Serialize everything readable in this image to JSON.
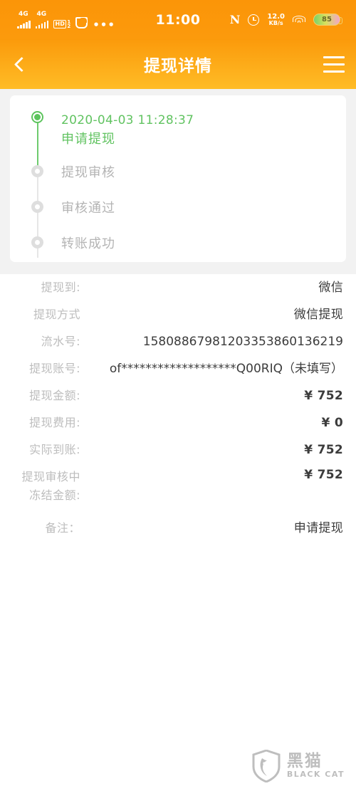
{
  "statusbar": {
    "carrier1": "4G",
    "carrier2": "4G",
    "hd_label": "HD",
    "hd_sim_top": "1",
    "hd_sim_bottom": "2",
    "more_dots": "•••",
    "clock": "11:00",
    "nfc_label": "N",
    "netspeed_value": "12.0",
    "netspeed_unit": "KB/s",
    "battery_percent": "85",
    "icons": {
      "signal": "signal-bars-icon",
      "hd": "hd-volte-icon",
      "bag": "shopping-bag-icon",
      "more": "more-dots-icon",
      "nfc": "nfc-icon",
      "alarm": "alarm-clock-icon",
      "wifi": "wifi-icon",
      "battery": "battery-icon"
    },
    "colors": {
      "bg_top": "#fb9508",
      "bg_bottom": "#fc9a0c"
    }
  },
  "navbar": {
    "back_icon": "chevron-left-icon",
    "title": "提现详情",
    "menu_icon": "hamburger-menu-icon",
    "colors": {
      "grad_top": "#fb9a0b",
      "grad_bottom": "#ffbc26"
    }
  },
  "timeline": {
    "active_color": "#5dc45d",
    "inactive_color": "#dedede",
    "steps": [
      {
        "timestamp": "2020-04-03 11:28:37",
        "label": "申请提现",
        "state": "active"
      },
      {
        "timestamp": "",
        "label": "提现审核",
        "state": "pending"
      },
      {
        "timestamp": "",
        "label": "审核通过",
        "state": "pending"
      },
      {
        "timestamp": "",
        "label": "转账成功",
        "state": "pending"
      }
    ]
  },
  "details": {
    "rows": [
      {
        "label": "提现到:",
        "value": "微信"
      },
      {
        "label": "提现方式",
        "value": "微信提现"
      },
      {
        "label": "流水号:",
        "value": "15808867981203353860136219"
      },
      {
        "label": "提现账号:",
        "value": "of*******************Q00RIQ（未填写）"
      },
      {
        "label": "提现金额:",
        "value": "¥ 752"
      },
      {
        "label": "提现费用:",
        "value": "¥ 0"
      },
      {
        "label": "实际到账:",
        "value": "¥ 752"
      },
      {
        "label": "提现审核中\n冻结金额:",
        "value": "¥ 752"
      },
      {
        "label": "备注：",
        "value": "申请提现"
      }
    ]
  },
  "watermark": {
    "logo_icon": "black-cat-shield-logo",
    "name_cn": "黑猫",
    "name_en": "BLACK CAT"
  }
}
